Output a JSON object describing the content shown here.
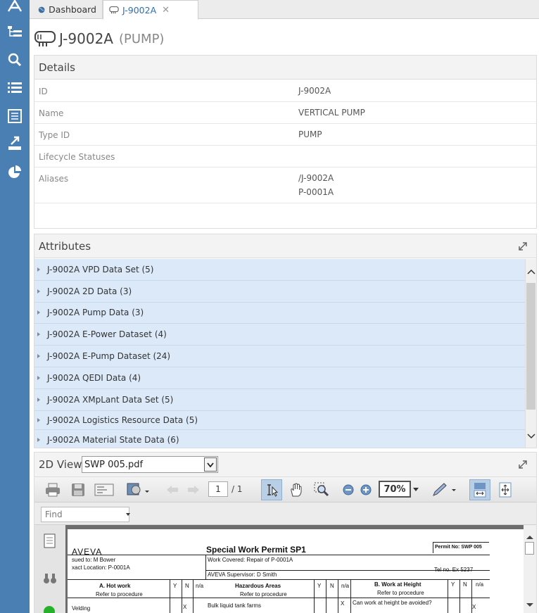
{
  "tabs": [
    {
      "label": "Dashboard"
    },
    {
      "label": "J-9002A"
    }
  ],
  "header": {
    "title": "J-9002A",
    "type": "(PUMP)"
  },
  "details": {
    "heading": "Details",
    "rows": [
      {
        "label": "ID",
        "value": "J-9002A"
      },
      {
        "label": "Name",
        "value": "VERTICAL PUMP"
      },
      {
        "label": "Type ID",
        "value": "PUMP"
      },
      {
        "label": "Lifecycle Statuses",
        "value": ""
      },
      {
        "label": "Aliases",
        "values": [
          "/J-9002A",
          "P-0001A"
        ]
      }
    ]
  },
  "attributes": {
    "heading": "Attributes",
    "items": [
      "J-9002A VPD Data Set (5)",
      "J-9002A 2D Data (3)",
      "J-9002A Pump Data (3)",
      "J-9002A E-Power Dataset (4)",
      "J-9002A E-Pump Dataset (24)",
      "J-9002A QEDI Data (4)",
      "J-9002A XMpLant Data Set (5)",
      "J-9002A Logistics Resource Data (5)",
      "J-9002A Material State Data (6)"
    ]
  },
  "view2d": {
    "heading": "2D View",
    "file": "SWP 005.pdf",
    "page_current": "1",
    "page_total": "/ 1",
    "zoom": "70%",
    "find_placeholder": "Find"
  },
  "document": {
    "logo": "AVEVA",
    "title": "Special Work Permit SP1",
    "permit_no": "Permit No:  SWP 005",
    "issued_to": "sued to: M Bower",
    "location": "xact Location: P-0001A",
    "work_covered": "Work Covered:       Repair of P-0001A",
    "supervisor": "AVEVA Supervisor: D Smith",
    "tel": "Tel no. Ex 5237",
    "col_a": "A. Hot work",
    "col_b": "Hazardous Areas",
    "col_c": "B. Work at Height",
    "yes": "Y",
    "no": "N",
    "na": "n/a",
    "refer": "Refer to procedure",
    "row1_a": "Velding",
    "row1_b": "Bulk liquid tank farms",
    "row1_c": "Can work at height be avoided?",
    "mark": "X"
  },
  "colors": {
    "rail": "#4a7fb4",
    "selection": "#dbe9f9",
    "accent": "#2a6ebb"
  }
}
